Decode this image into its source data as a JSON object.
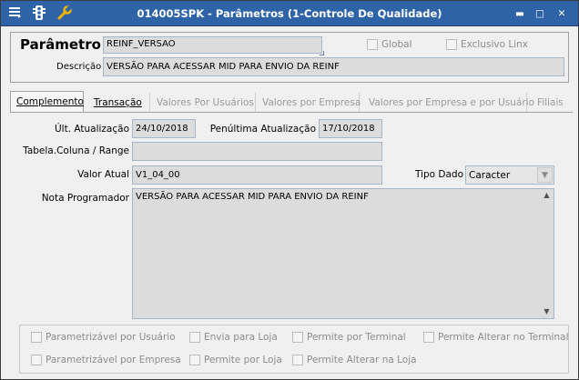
{
  "window": {
    "title": "014005SPK - Parâmetros (1-Controle De Qualidade)",
    "icons": [
      "menu-icon",
      "traffic-light-icon",
      "wrench-icon"
    ],
    "controls": {
      "minimize": "▬",
      "maximize": "□",
      "close": "✕"
    }
  },
  "header": {
    "title": "Parâmetro",
    "parameter_value": "REINF_VERSAO",
    "global_label": "Global",
    "exclusivo_label": "Exclusivo Linx",
    "description_label": "Descrição",
    "description_value": "VERSÃO PARA ACESSAR MID PARA ENVIO DA REINF"
  },
  "tabs": [
    {
      "label": "Complemento",
      "state": "active"
    },
    {
      "label": "Transação",
      "state": "enabled"
    },
    {
      "label": "Valores Por Usuários",
      "state": "disabled"
    },
    {
      "label": "Valores por Empresa",
      "state": "disabled"
    },
    {
      "label": "Valores por Empresa e por Usuário",
      "state": "disabled"
    },
    {
      "label": "Filiais",
      "state": "disabled"
    }
  ],
  "form": {
    "ult_atualizacao_label": "Últ. Atualização",
    "ult_atualizacao_value": "24/10/2018",
    "penultima_label": "Penúltima Atualização",
    "penultima_value": "17/10/2018",
    "tabela_label": "Tabela.Coluna / Range",
    "tabela_value": "",
    "valor_atual_label": "Valor Atual",
    "valor_atual_value": "V1_04_00",
    "tipo_dado_label": "Tipo Dado",
    "tipo_dado_value": "Caracter",
    "nota_label": "Nota Programador",
    "nota_value": "VERSÃO PARA ACESSAR MID PARA ENVIO DA REINF"
  },
  "options": {
    "parametrizavel_usuario": "Parametrizável por Usuário",
    "envia_loja": "Envia para Loja",
    "permite_terminal": "Permite por Terminal",
    "permite_alterar_terminal": "Permite Alterar no Terminal",
    "parametrizavel_empresa": "Parametrizável por Empresa",
    "permite_loja": "Permite por Loja",
    "permite_alterar_loja": "Permite Alterar na Loja"
  },
  "colors": {
    "titlebar": "#2f63a8",
    "readonly_field": "#dcdcdc",
    "disabled_text": "#9a9a9a"
  }
}
